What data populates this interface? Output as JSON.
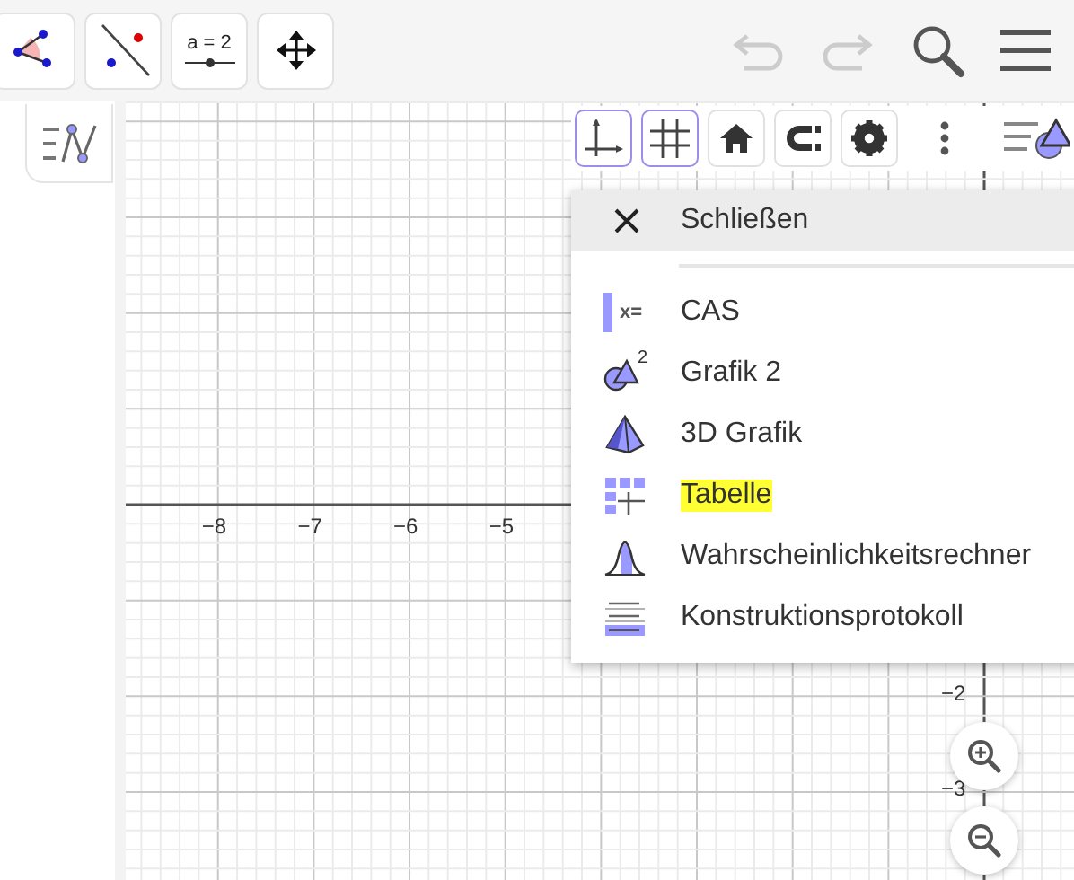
{
  "toolbar": {
    "tools": [
      {
        "kind": "angle"
      },
      {
        "kind": "line-point"
      },
      {
        "kind": "slider",
        "label": "a = 2"
      },
      {
        "kind": "move"
      }
    ]
  },
  "graphics": {
    "x_labels": [
      "−8",
      "−7",
      "−6",
      "−5"
    ],
    "y_labels": [
      "−2",
      "−3"
    ]
  },
  "style_bar": {
    "buttons": [
      {
        "kind": "axes",
        "selected": true
      },
      {
        "kind": "grid",
        "selected": true
      },
      {
        "kind": "home",
        "selected": false
      },
      {
        "kind": "magnet",
        "selected": false
      },
      {
        "kind": "gear",
        "selected": false
      }
    ]
  },
  "view_menu": {
    "close_label": "Schließen",
    "items": [
      {
        "kind": "cas",
        "label": "CAS",
        "icon_text": "x=",
        "highlighted": false
      },
      {
        "kind": "graphics2",
        "label": "Grafik 2",
        "icon_text": "2",
        "highlighted": false
      },
      {
        "kind": "pyramid",
        "label": "3D Grafik",
        "highlighted": false
      },
      {
        "kind": "table",
        "label": "Tabelle",
        "highlighted": true
      },
      {
        "kind": "probability",
        "label": "Wahrscheinlichkeitsrechner",
        "highlighted": false
      },
      {
        "kind": "protocol",
        "label": "Konstruktionsprotokoll",
        "highlighted": false
      }
    ]
  }
}
